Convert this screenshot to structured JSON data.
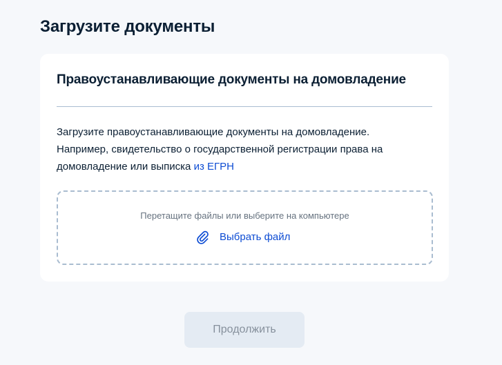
{
  "page": {
    "title": "Загрузите документы"
  },
  "card": {
    "title": "Правоустанавливающие документы на домовладение",
    "description_line1": "Загрузите правоустанавливающие документы на домовладение.",
    "description_line2": "Например, свидетельство о государственной регистрации права на",
    "description_line3_text": "домовладение или выписка ",
    "description_link": "из ЕГРН",
    "dropzone": {
      "hint": "Перетащите файлы или выберите на компьютере",
      "choose_label": "Выбрать файл",
      "icon": "paperclip-icon"
    }
  },
  "footer": {
    "continue_label": "Продолжить",
    "continue_state": "disabled"
  },
  "colors": {
    "background": "#f6f8fb",
    "card": "#ffffff",
    "text": "#0b1f33",
    "link": "#0d4cd3",
    "divider": "#a9bcd0",
    "hint": "#66727f",
    "button_disabled_bg": "#e4ebf3",
    "button_disabled_text": "#86909c"
  }
}
